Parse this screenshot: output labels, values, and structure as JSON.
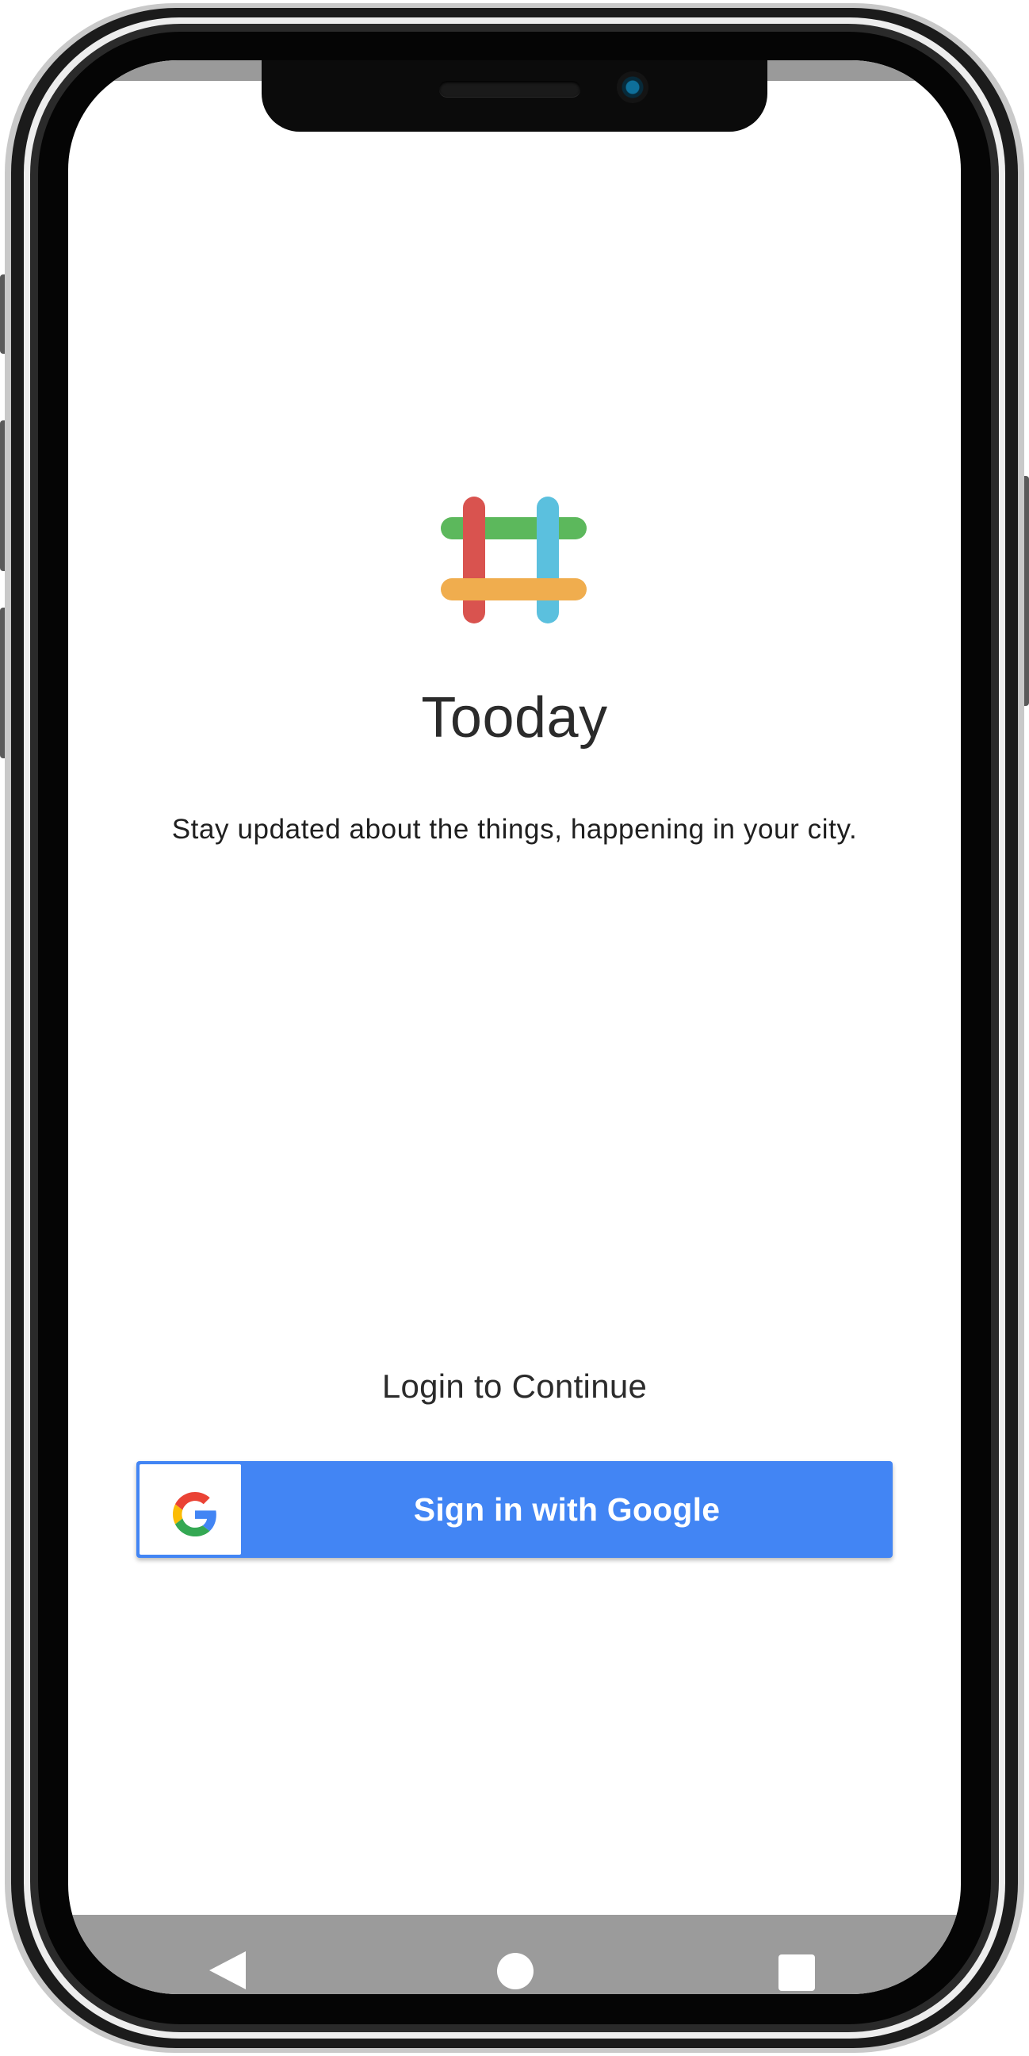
{
  "app": {
    "name": "Tooday",
    "tagline": "Stay updated about the things, happening in your city."
  },
  "login": {
    "prompt": "Login to Continue",
    "google_button_label": "Sign in with Google"
  },
  "icons": {
    "logo": "hashtag-logo-icon",
    "google": "google-g-icon",
    "nav_back": "back-triangle-icon",
    "nav_home": "home-circle-icon",
    "nav_recent": "recent-apps-square-icon"
  },
  "colors": {
    "logo_green": "#5cb85c",
    "logo_blue": "#5bc0de",
    "logo_red": "#d9534f",
    "logo_orange": "#f0ad4e",
    "google_button_blue": "#4285f4",
    "navbar_gray": "#9b9b9b"
  }
}
